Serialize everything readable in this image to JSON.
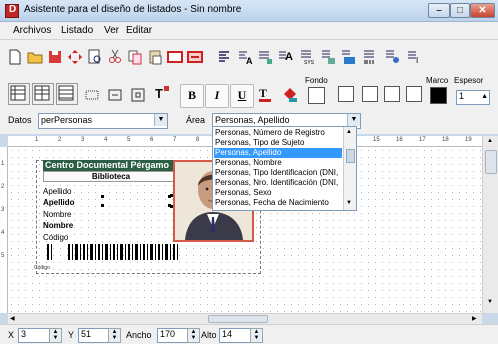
{
  "window": {
    "title": "Asistente para el diseño de listados - Sin nombre",
    "app_icon_letter": "D"
  },
  "menu": [
    "Archivos",
    "Listado",
    "Ver",
    "Editar"
  ],
  "toolbar": {
    "fondo_label": "Fondo",
    "marco_label": "Marco",
    "espesor_label": "Espesor",
    "espesor_value": "1",
    "bold_label": "B",
    "italic_label": "I",
    "underline_label": "U"
  },
  "databar": {
    "datos_label": "Datos",
    "datos_value": "perPersonas",
    "area_label": "Área",
    "area_value": "Personas, Apellido"
  },
  "area_options": [
    "Personas, Número de Registro",
    "Personas, Tipo de Sujeto",
    "Personas, Apellido",
    "Personas, Nombre",
    "Personas, Tipo Identificacion (DNI,",
    "Personas, Nro. Identificación (DNI,",
    "Personas, Sexo",
    "Personas, Fecha de Nacimiento"
  ],
  "selected_option_index": 2,
  "ruler_h": [
    "1",
    "2",
    "3",
    "4",
    "5",
    "6",
    "7",
    "8",
    "9",
    "10",
    "11",
    "12",
    "13",
    "14",
    "15",
    "16",
    "17",
    "18",
    "19"
  ],
  "ruler_v": [
    "1",
    "2",
    "3",
    "4",
    "5"
  ],
  "card": {
    "title": "Centro Documental Pérgamo",
    "subtitle": "Biblioteca",
    "apellido_label": "Apellido",
    "apellido_value": "Apellido",
    "nombre_label": "Nombre",
    "nombre_value": "Nombre",
    "codigo_label": "Código",
    "barcode_caption": "Código"
  },
  "statusbar": {
    "x_label": "X",
    "x_value": "3",
    "y_label": "Y",
    "y_value": "51",
    "ancho_label": "Ancho",
    "ancho_value": "170",
    "alto_label": "Alto",
    "alto_value": "14"
  },
  "colors": {
    "card_header": "#2b5e44",
    "selection": "#3399ff",
    "photo_border": "#d55a4a",
    "close_button": "#c7432b"
  }
}
